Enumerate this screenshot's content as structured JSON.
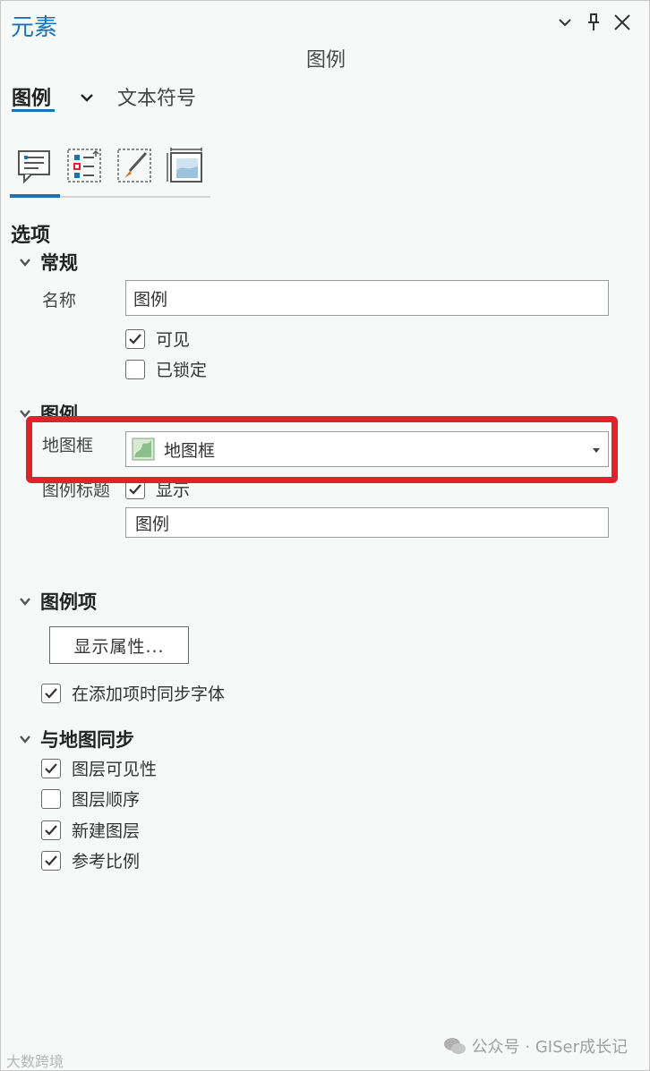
{
  "pane": {
    "title": "元素",
    "subtitle": "图例"
  },
  "header_icons": [
    "chevron-down-icon",
    "pin-icon",
    "close-icon"
  ],
  "tabs": {
    "active": "图例",
    "other": "文本符号"
  },
  "toolbar": {
    "icons": [
      "legend-options-icon",
      "legend-arrange-icon",
      "legend-symbol-icon",
      "legend-display-icon"
    ]
  },
  "options": {
    "section_title": "选项",
    "general": {
      "title": "常规",
      "name_label": "名称",
      "name_value": "图例",
      "visible_label": "可见",
      "visible_checked": true,
      "locked_label": "已锁定",
      "locked_checked": false
    },
    "legend": {
      "title": "图例",
      "map_frame_label": "地图框",
      "map_frame_value": "地图框",
      "legend_title_label": "图例标题",
      "show_label": "显示",
      "show_checked": true,
      "legend_title_value": "图例"
    },
    "legend_items": {
      "title": "图例项",
      "display_props_button": "显示属性...",
      "sync_font_label": "在添加项时同步字体",
      "sync_font_checked": true
    },
    "sync_with_map": {
      "title": "与地图同步",
      "items": [
        {
          "label": "图层可见性",
          "checked": true
        },
        {
          "label": "图层顺序",
          "checked": false
        },
        {
          "label": "新建图层",
          "checked": true
        },
        {
          "label": "参考比例",
          "checked": true
        }
      ]
    }
  },
  "watermarks": {
    "right": "公众号 · GISer成长记",
    "left": "大数跨境"
  },
  "colors": {
    "accent": "#1a73b8",
    "highlight_box": "#e0222d"
  }
}
